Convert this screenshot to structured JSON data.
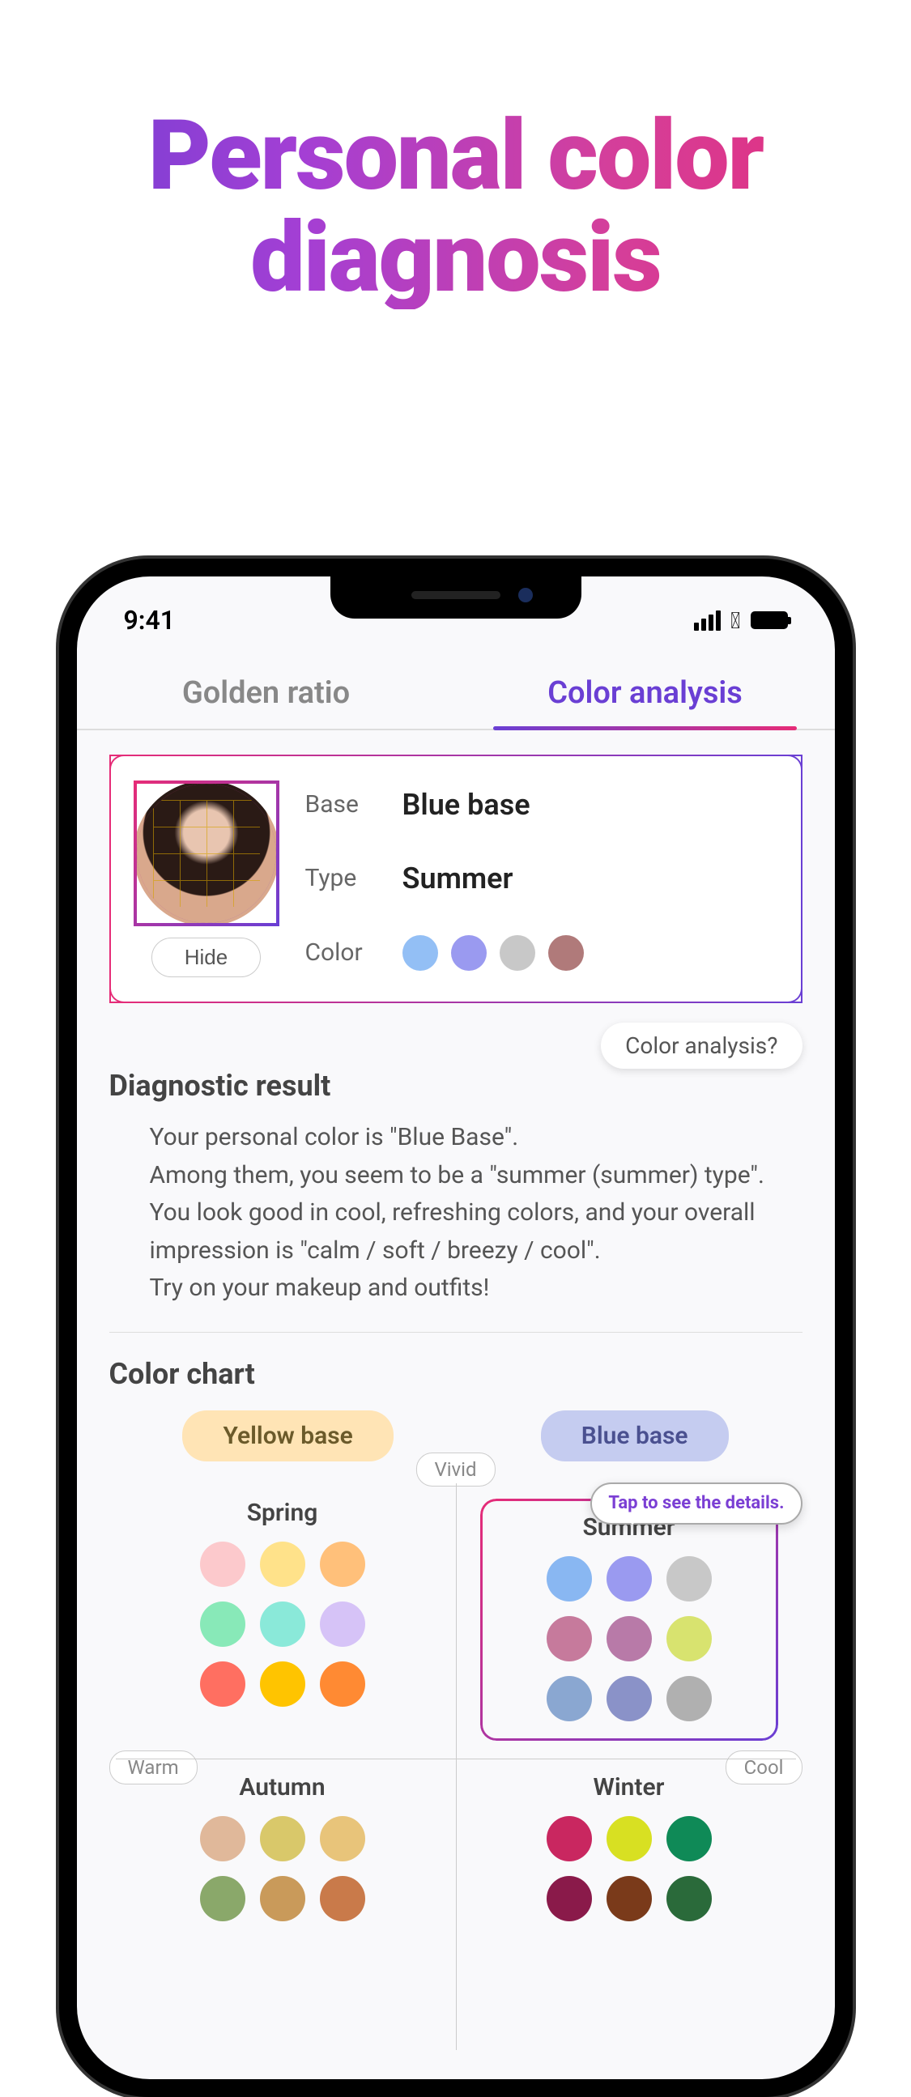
{
  "marketing": {
    "title_line1": "Personal color",
    "title_line2": "diagnosis"
  },
  "status": {
    "time": "9:41"
  },
  "tabs": {
    "golden_ratio": "Golden ratio",
    "color_analysis": "Color analysis"
  },
  "result_card": {
    "hide_btn": "Hide",
    "base_label": "Base",
    "base_value": "Blue base",
    "type_label": "Type",
    "type_value": "Summer",
    "color_label": "Color",
    "colors": [
      "#93bff5",
      "#9a9af0",
      "#c8c8c8",
      "#b07a7a"
    ]
  },
  "analysis_link": "Color analysis?",
  "diagnostic": {
    "title": "Diagnostic result",
    "line1": "Your personal color is \"Blue Base\".",
    "line2": "Among them, you seem to be a \"summer (summer) type\".",
    "line3": "You look good in cool, refreshing colors, and your overall impression is \"calm / soft / breezy / cool\".",
    "line4": "Try on your makeup and outfits!"
  },
  "chart": {
    "title": "Color chart",
    "yellow_base": "Yellow base",
    "blue_base": "Blue base",
    "axis_vivid": "Vivid",
    "axis_warm": "Warm",
    "axis_cool": "Cool",
    "tooltip": "Tap to see the details.",
    "seasons": {
      "spring": {
        "name": "Spring",
        "colors": [
          "#fcc9cc",
          "#ffe28a",
          "#ffc07a",
          "#88e9b8",
          "#8ae9d9",
          "#d6c3f7",
          "#ff6f61",
          "#ffc400",
          "#ff8a33"
        ]
      },
      "summer": {
        "name": "Summer",
        "colors": [
          "#89b7f2",
          "#9a9af0",
          "#c8c8c8",
          "#c67a9c",
          "#b87aa8",
          "#d8e36f",
          "#8aa7d1",
          "#8a92c8",
          "#b0b0b0"
        ]
      },
      "autumn": {
        "name": "Autumn",
        "colors": [
          "#e0b89a",
          "#d9c86a",
          "#e8c47a",
          "#8aa86a",
          "#c99a5a",
          "#c97a4a"
        ]
      },
      "winter": {
        "name": "Winter",
        "colors": [
          "#c92760",
          "#d8e022",
          "#0f8a57",
          "#8a1a4a",
          "#7a3a1a",
          "#2a6a3a"
        ]
      }
    }
  }
}
